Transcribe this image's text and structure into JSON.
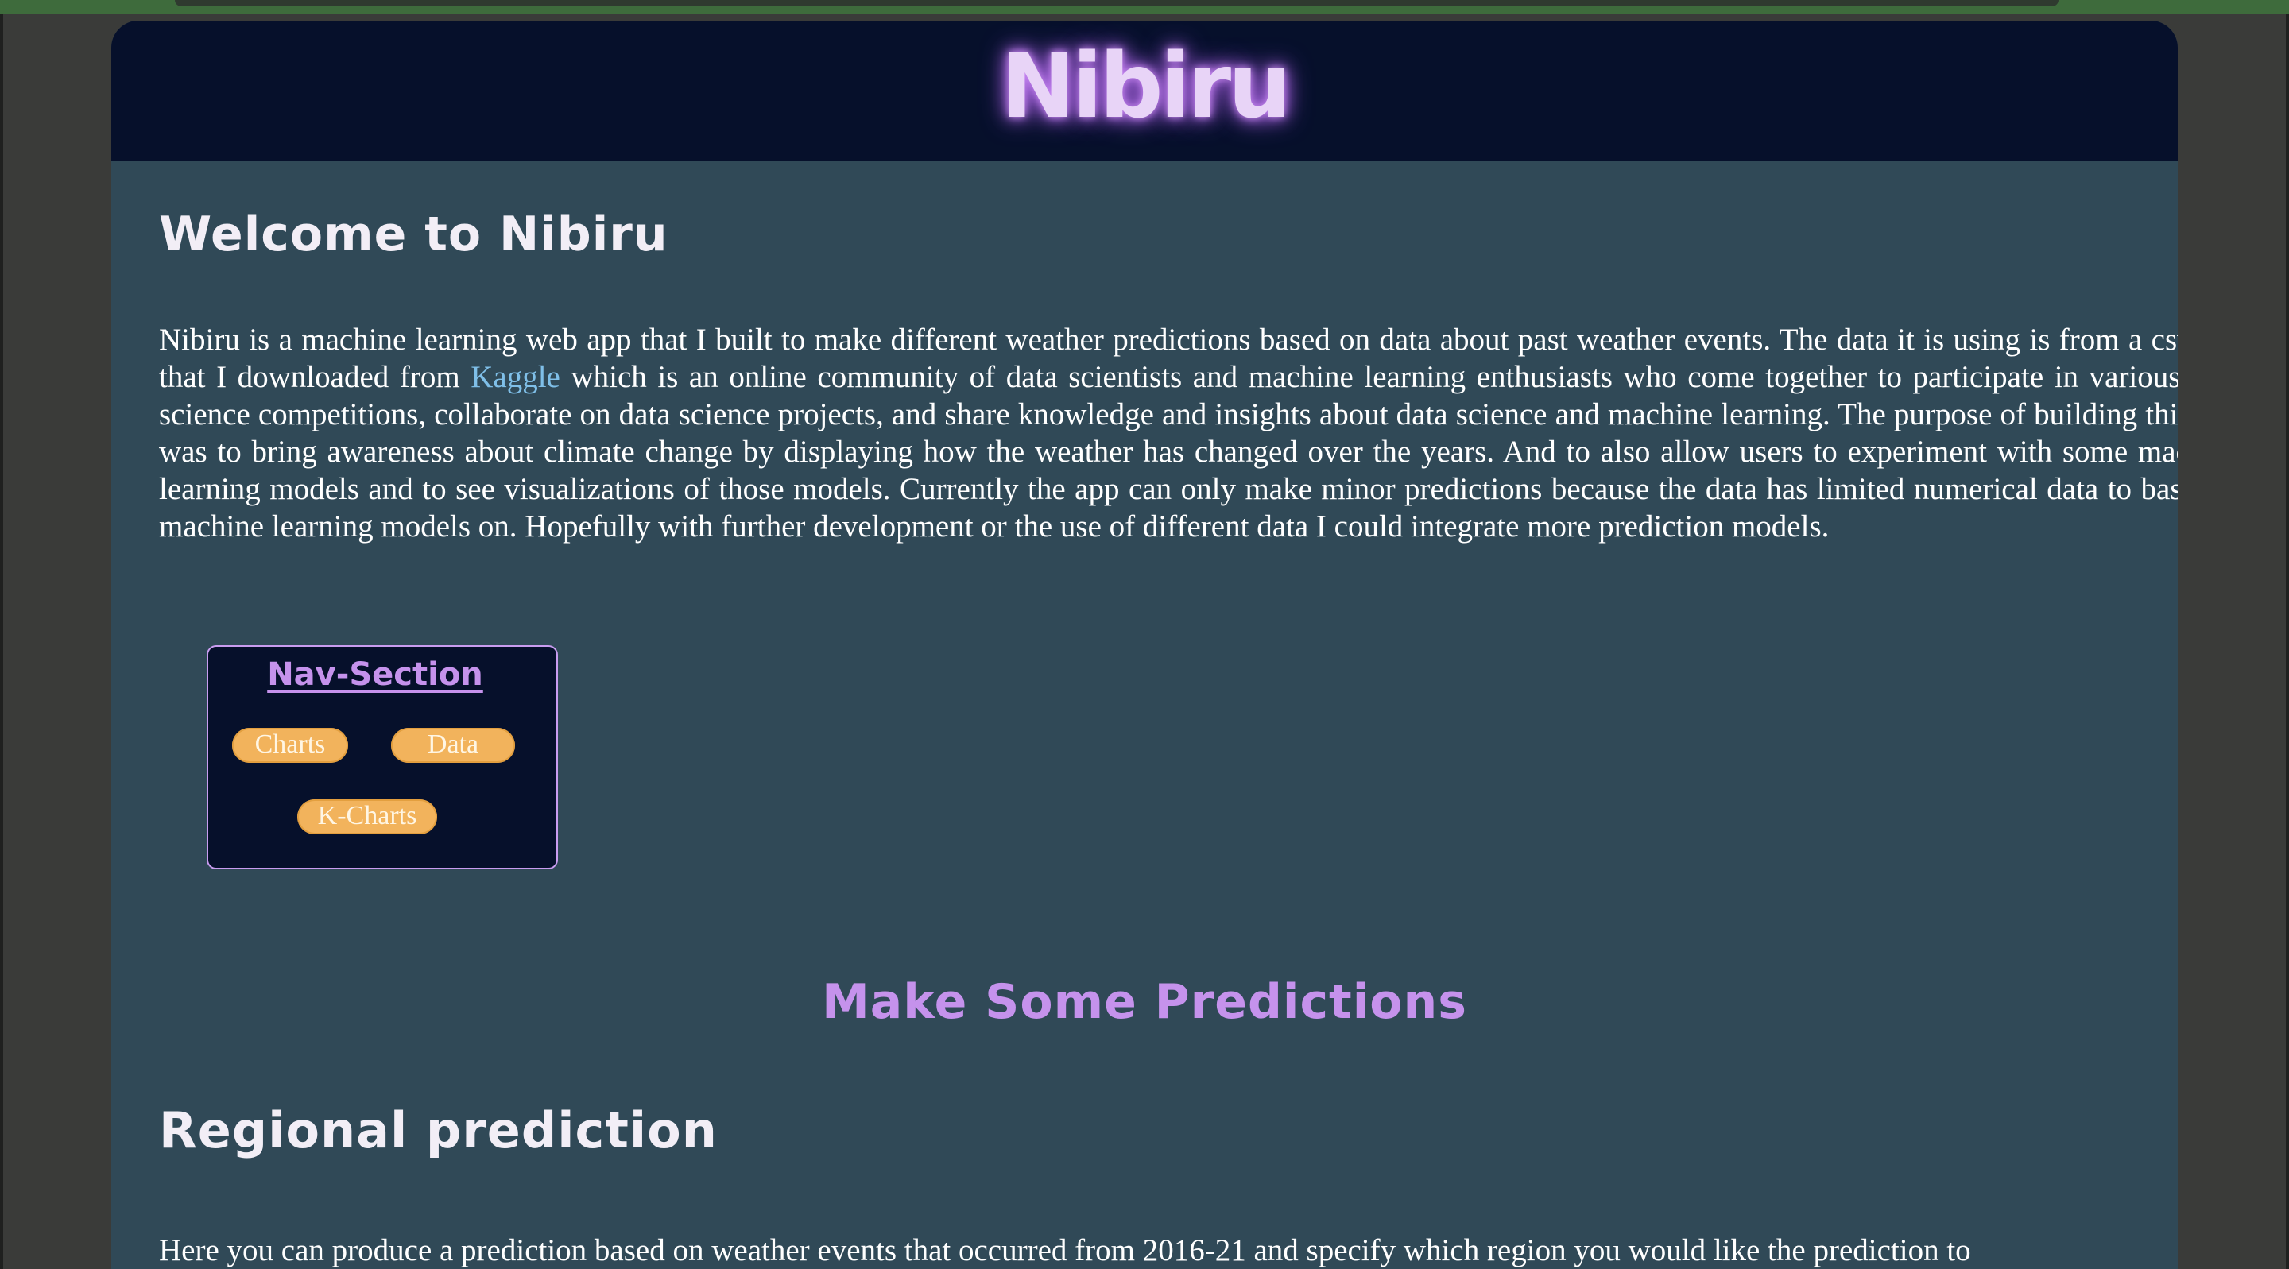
{
  "header": {
    "site_title": "Nibiru"
  },
  "welcome": {
    "heading": "Welcome to Nibiru",
    "intro_before_link": "Nibiru is a machine learning web app that I built to make different weather predictions based on data about past weather events. The data it is using is from a csv file that I downloaded from ",
    "link_text": "Kaggle",
    "intro_after_link": " which is an online community of data scientists and machine learning enthusiasts who come together to participate in various data science competitions, collaborate on data science projects, and share knowledge and insights about data science and machine learning. The purpose of building this app was to bring awareness about climate change by displaying how the weather has changed over the years. And to also allow users to experiment with some machine learning models and to see visualizations of those models. Currently the app can only make minor predictions because the data has limited numerical data to base the machine learning models on. Hopefully with further development or the use of different data I could integrate more prediction models."
  },
  "nav_section": {
    "title": "Nav-Section",
    "buttons": [
      {
        "label": "Charts"
      },
      {
        "label": "Data"
      },
      {
        "label": "K-Charts"
      }
    ]
  },
  "predictions": {
    "heading": "Make Some Predictions"
  },
  "regional": {
    "heading": "Regional prediction",
    "text": "Here you can produce a prediction based on weather events that occurred from 2016-21 and specify which region you would like the prediction to"
  },
  "colors": {
    "header_bg": "#06102b",
    "content_bg": "#304957",
    "accent_purple": "#c592ec",
    "button_orange": "#f2b35c",
    "link_blue": "#7fbfe8"
  }
}
